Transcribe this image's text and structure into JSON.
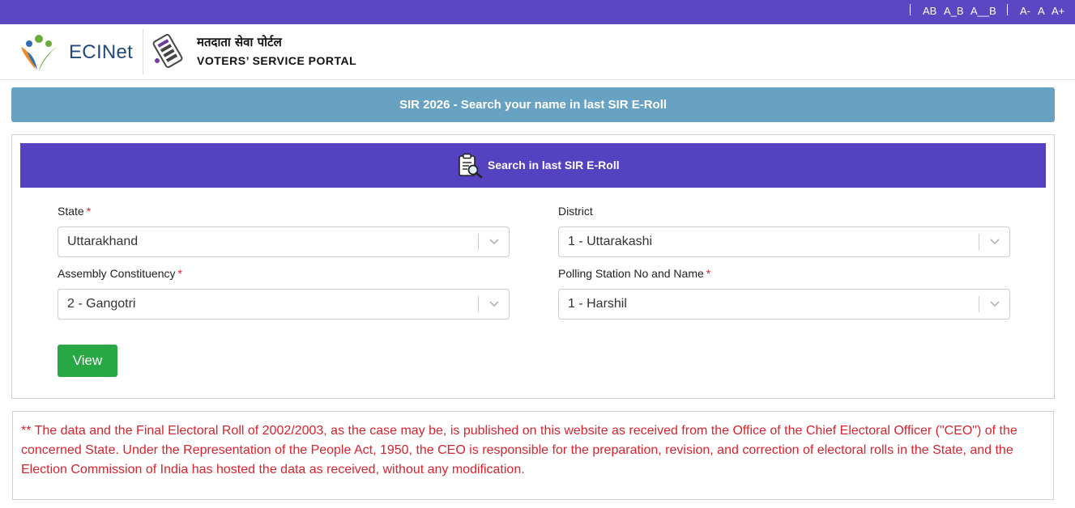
{
  "accessibility": {
    "contrast": [
      "AB",
      "A_B",
      "A__B"
    ],
    "font_size": [
      "A-",
      "A",
      "A+"
    ]
  },
  "header": {
    "brand": "ECINet",
    "portal_title_hi": "मतदाता सेवा पोर्टल",
    "portal_title_en": "VOTERS’ SERVICE PORTAL"
  },
  "banner": {
    "title": "SIR 2026 - Search your name in last SIR E-Roll"
  },
  "search_panel": {
    "title": "Search in last SIR E-Roll",
    "required_mark": "*",
    "fields": {
      "state": {
        "label": "State",
        "value": "Uttarakhand"
      },
      "district": {
        "label": "District",
        "value": "1 - Uttarakashi"
      },
      "assembly": {
        "label": "Assembly Constituency",
        "value": "2 - Gangotri"
      },
      "polling_station": {
        "label": "Polling Station No and Name",
        "value": "1 - Harshil"
      }
    },
    "view_button": "View"
  },
  "notice": {
    "text": "** The data and the Final Electoral Roll of 2002/2003, as the case may be, is published on this website as received from the Office of the Chief Electoral Officer (\"CEO\") of the concerned State. Under the Representation of the People Act, 1950, the CEO is responsible for the preparation, revision, and correction of electoral rolls in the State, and the Election Commission of India has hosted the data as received, without any modification."
  },
  "colors": {
    "topbar": "#5a47c1",
    "banner": "#68a2c2",
    "panel_header": "#5442c0",
    "view_button": "#28a745",
    "notice_text": "#d9232d",
    "brand_text": "#234a7c"
  },
  "icons": {
    "brand_logo": "ecinet-logo",
    "portal_logo": "voters-portal-logo",
    "panel_icon": "clipboard-search-icon",
    "dropdown": "chevron-down-icon"
  }
}
